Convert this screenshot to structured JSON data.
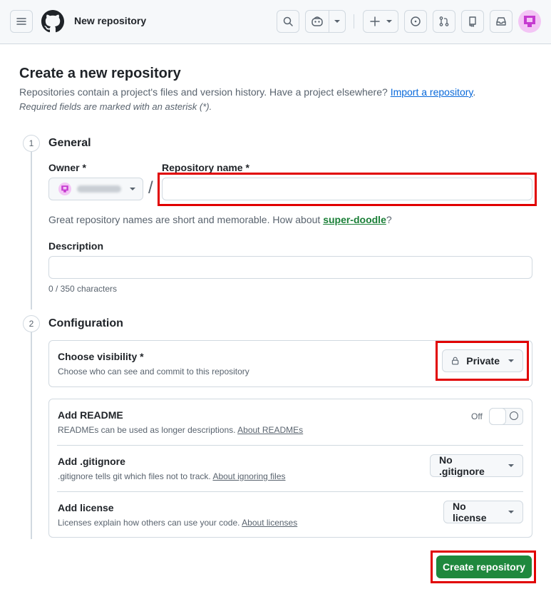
{
  "header": {
    "title": "New repository"
  },
  "page": {
    "title": "Create a new repository",
    "intro_text": "Repositories contain a project's files and version history. Have a project elsewhere? ",
    "import_link": "Import a repository",
    "intro_end": ".",
    "required_note": "Required fields are marked with an asterisk (*)."
  },
  "general": {
    "step": "1",
    "title": "General",
    "owner_label": "Owner *",
    "repo_name_label": "Repository name *",
    "repo_name_value": "",
    "slash": "/",
    "name_hint_prefix": "Great repository names are short and memorable. How about ",
    "name_suggestion": "super-doodle",
    "name_hint_suffix": "?",
    "description_label": "Description",
    "description_value": "",
    "char_count": "0 / 350 characters"
  },
  "configuration": {
    "step": "2",
    "title": "Configuration",
    "visibility": {
      "title": "Choose visibility *",
      "desc": "Choose who can see and commit to this repository",
      "selected": "Private"
    },
    "readme": {
      "title": "Add README",
      "desc": "READMEs can be used as longer descriptions. ",
      "link": "About READMEs",
      "toggle_state": "Off"
    },
    "gitignore": {
      "title": "Add .gitignore",
      "desc": ".gitignore tells git which files not to track. ",
      "link": "About ignoring files",
      "selected": "No .gitignore"
    },
    "license": {
      "title": "Add license",
      "desc": "Licenses explain how others can use your code. ",
      "link": "About licenses",
      "selected": "No license"
    }
  },
  "actions": {
    "create_label": "Create repository"
  },
  "colors": {
    "primary_green": "#1f883d",
    "link_blue": "#0969da",
    "suggestion_green": "#1a7f37",
    "annotation_red": "#e10000"
  },
  "icons": [
    "hamburger-icon",
    "github-logo-icon",
    "search-icon",
    "copilot-icon",
    "plus-icon",
    "issue-icon",
    "pull-request-icon",
    "repo-icon",
    "inbox-icon",
    "avatar-identicon",
    "lock-icon"
  ]
}
